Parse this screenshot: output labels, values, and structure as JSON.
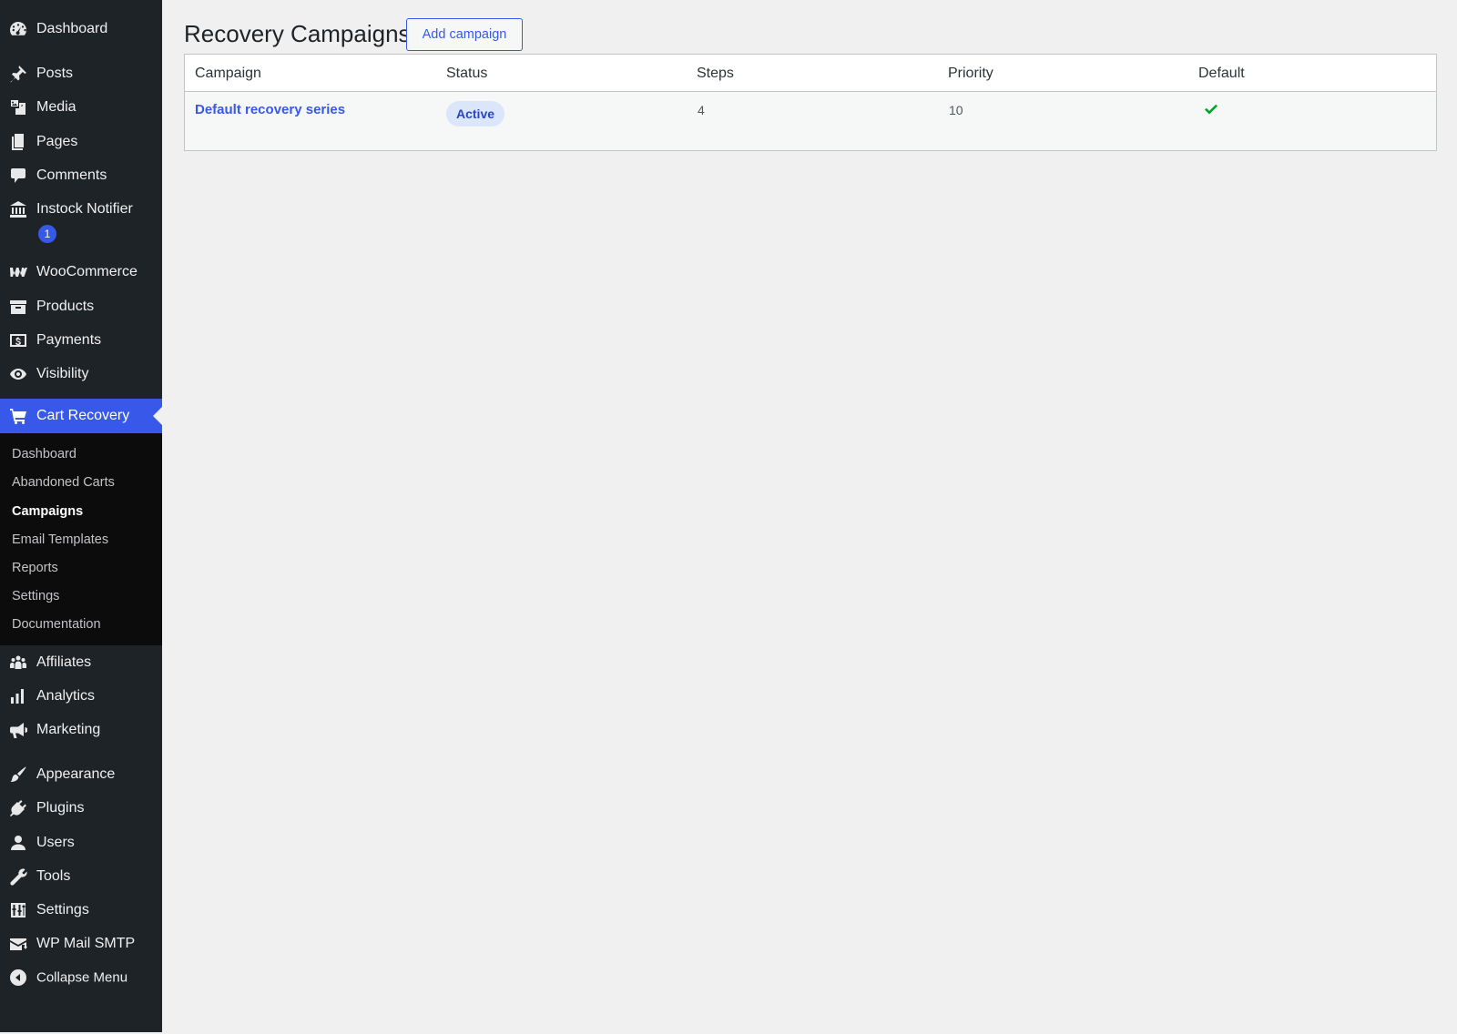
{
  "sidebar": {
    "items": [
      {
        "label": "Dashboard",
        "icon": "dashboard-icon"
      },
      {
        "label": "Posts",
        "icon": "pin-icon"
      },
      {
        "label": "Media",
        "icon": "media-icon"
      },
      {
        "label": "Pages",
        "icon": "pages-icon"
      },
      {
        "label": "Comments",
        "icon": "comment-icon"
      },
      {
        "label": "Instock Notifier",
        "icon": "bank-icon",
        "badge": "1"
      },
      {
        "label": "WooCommerce",
        "icon": "woocommerce-icon"
      },
      {
        "label": "Products",
        "icon": "archive-icon"
      },
      {
        "label": "Payments",
        "icon": "dollar-icon"
      },
      {
        "label": "Visibility",
        "icon": "eye-icon"
      },
      {
        "label": "Cart Recovery",
        "icon": "cart-icon",
        "current": true
      },
      {
        "label": "Affiliates",
        "icon": "groups-icon"
      },
      {
        "label": "Analytics",
        "icon": "chart-bar-icon"
      },
      {
        "label": "Marketing",
        "icon": "megaphone-icon"
      },
      {
        "label": "Appearance",
        "icon": "paintbrush-icon"
      },
      {
        "label": "Plugins",
        "icon": "plugin-icon"
      },
      {
        "label": "Users",
        "icon": "user-icon"
      },
      {
        "label": "Tools",
        "icon": "wrench-icon"
      },
      {
        "label": "Settings",
        "icon": "settings-icon"
      },
      {
        "label": "WP Mail SMTP",
        "icon": "mail-icon"
      },
      {
        "label": "Collapse Menu",
        "icon": "collapse-icon"
      }
    ],
    "submenu": [
      {
        "label": "Dashboard"
      },
      {
        "label": "Abandoned Carts"
      },
      {
        "label": "Campaigns",
        "active": true
      },
      {
        "label": "Email Templates"
      },
      {
        "label": "Reports"
      },
      {
        "label": "Settings"
      },
      {
        "label": "Documentation"
      }
    ]
  },
  "main": {
    "title": "Recovery Campaigns",
    "add_button": "Add campaign",
    "table": {
      "columns": [
        "Campaign",
        "Status",
        "Steps",
        "Priority",
        "Default"
      ],
      "rows": [
        {
          "campaign": "Default recovery series",
          "status": "Active",
          "steps": "4",
          "priority": "10",
          "default": true
        }
      ]
    }
  },
  "colors": {
    "sidebar_bg": "#1d2327",
    "accent": "#3858e9",
    "success": "#00a32a"
  }
}
